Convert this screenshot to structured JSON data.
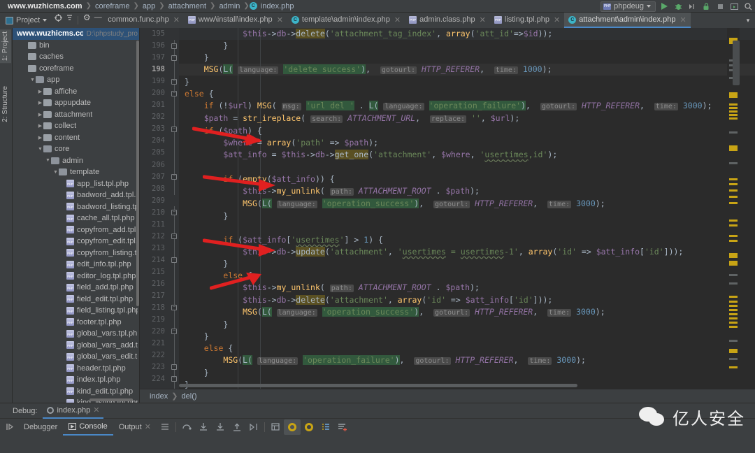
{
  "navbar": {
    "breadcrumbs": [
      "www.wuzhicms.com",
      "coreframe",
      "app",
      "attachment",
      "admin",
      "index.php"
    ],
    "run_config": "phpdeug",
    "php_badge": "PHP"
  },
  "toolwindow": {
    "project_button": "Project",
    "left_tabs": [
      "1: Project",
      "2: Structure"
    ]
  },
  "tabs": [
    {
      "label": "common.func.php",
      "icon": "php-file-icon",
      "active": false
    },
    {
      "label": "www\\install\\index.php",
      "icon": "php-file-icon",
      "active": false
    },
    {
      "label": "template\\admin\\index.php",
      "icon": "class-file-icon",
      "active": false
    },
    {
      "label": "admin.class.php",
      "icon": "php-file-icon",
      "active": false
    },
    {
      "label": "listing.tpl.php",
      "icon": "php-file-icon",
      "active": false
    },
    {
      "label": "attachment\\admin\\index.php",
      "icon": "class-file-icon",
      "active": true
    }
  ],
  "tree": {
    "root": {
      "name": "www.wuzhicms.com",
      "path": "D:\\phpstudy_pro"
    },
    "items": [
      {
        "label": "bin",
        "depth": 1,
        "type": "folder",
        "arrow": ""
      },
      {
        "label": "caches",
        "depth": 1,
        "type": "folder",
        "arrow": ""
      },
      {
        "label": "coreframe",
        "depth": 1,
        "type": "folder",
        "arrow": ""
      },
      {
        "label": "app",
        "depth": 2,
        "type": "folder",
        "arrow": "down"
      },
      {
        "label": "affiche",
        "depth": 3,
        "type": "folder",
        "arrow": "right"
      },
      {
        "label": "appupdate",
        "depth": 3,
        "type": "folder",
        "arrow": "right"
      },
      {
        "label": "attachment",
        "depth": 3,
        "type": "folder",
        "arrow": "right"
      },
      {
        "label": "collect",
        "depth": 3,
        "type": "folder",
        "arrow": "right"
      },
      {
        "label": "content",
        "depth": 3,
        "type": "folder",
        "arrow": "right"
      },
      {
        "label": "core",
        "depth": 3,
        "type": "folder",
        "arrow": "down"
      },
      {
        "label": "admin",
        "depth": 4,
        "type": "folder",
        "arrow": "down"
      },
      {
        "label": "template",
        "depth": 5,
        "type": "folder",
        "arrow": "down"
      },
      {
        "label": "app_list.tpl.php",
        "depth": 6,
        "type": "file",
        "arrow": ""
      },
      {
        "label": "badword_add.tpl.ph",
        "depth": 6,
        "type": "file",
        "arrow": ""
      },
      {
        "label": "badword_listing.tpl.",
        "depth": 6,
        "type": "file",
        "arrow": ""
      },
      {
        "label": "cache_all.tpl.php",
        "depth": 6,
        "type": "file",
        "arrow": ""
      },
      {
        "label": "copyfrom_add.tpl.ph",
        "depth": 6,
        "type": "file",
        "arrow": ""
      },
      {
        "label": "copyfrom_edit.tpl.ph",
        "depth": 6,
        "type": "file",
        "arrow": ""
      },
      {
        "label": "copyfrom_listing.tpl.",
        "depth": 6,
        "type": "file",
        "arrow": ""
      },
      {
        "label": "edit_info.tpl.php",
        "depth": 6,
        "type": "file",
        "arrow": ""
      },
      {
        "label": "editor_log.tpl.php",
        "depth": 6,
        "type": "file",
        "arrow": ""
      },
      {
        "label": "field_add.tpl.php",
        "depth": 6,
        "type": "file",
        "arrow": ""
      },
      {
        "label": "field_edit.tpl.php",
        "depth": 6,
        "type": "file",
        "arrow": ""
      },
      {
        "label": "field_listing.tpl.php",
        "depth": 6,
        "type": "file",
        "arrow": ""
      },
      {
        "label": "footer.tpl.php",
        "depth": 6,
        "type": "file",
        "arrow": ""
      },
      {
        "label": "global_vars.tpl.php",
        "depth": 6,
        "type": "file",
        "arrow": ""
      },
      {
        "label": "global_vars_add.tpl.",
        "depth": 6,
        "type": "file",
        "arrow": ""
      },
      {
        "label": "global_vars_edit.tpl.",
        "depth": 6,
        "type": "file",
        "arrow": ""
      },
      {
        "label": "header.tpl.php",
        "depth": 6,
        "type": "file",
        "arrow": ""
      },
      {
        "label": "index.tpl.php",
        "depth": 6,
        "type": "file",
        "arrow": ""
      },
      {
        "label": "kind_edit.tpl.php",
        "depth": 6,
        "type": "file",
        "arrow": ""
      },
      {
        "label": "kind_listing.tpl.php",
        "depth": 6,
        "type": "file",
        "arrow": ""
      }
    ]
  },
  "editor": {
    "first_line": 195,
    "last_line": 224,
    "current_line": 198,
    "breadcrumb": [
      "index",
      "del()"
    ],
    "browsers": [
      "chrome-icon",
      "firefox-icon",
      "safari-icon",
      "opera-icon",
      "ie-icon",
      "edge-icon"
    ],
    "lines": [
      {
        "n": 195,
        "indent": 0,
        "text": "$this->db->delete('attachment_tag_index', array('att_id'=>$id));"
      },
      {
        "n": 196,
        "indent": 0,
        "text": "}"
      },
      {
        "n": 197,
        "indent": 0,
        "text": "}"
      },
      {
        "n": 198,
        "indent": 0,
        "text": "MSG(L( language: 'delete success'),  gotourl: HTTP_REFERER,  time: 1000);"
      },
      {
        "n": 199,
        "indent": 0,
        "text": "}"
      },
      {
        "n": 200,
        "indent": 0,
        "text": "else {"
      },
      {
        "n": 201,
        "indent": 0,
        "text": "if (!$url) MSG( msg: 'url del ' . L( language: 'operation_failure'),  gotourl: HTTP_REFERER,  time: 3000);"
      },
      {
        "n": 202,
        "indent": 0,
        "text": "$path = str_ireplace( search: ATTACHMENT_URL,  replace: '', $url);"
      },
      {
        "n": 203,
        "indent": 0,
        "text": "if ($path) {"
      },
      {
        "n": 204,
        "indent": 0,
        "text": "$where = array('path' => $path);"
      },
      {
        "n": 205,
        "indent": 0,
        "text": "$att_info = $this->db->get_one('attachment', $where, 'usertimes,id');"
      },
      {
        "n": 206,
        "indent": 0,
        "text": ""
      },
      {
        "n": 207,
        "indent": 0,
        "text": "if (empty($att_info)) {"
      },
      {
        "n": 208,
        "indent": 0,
        "text": "$this->my_unlink( path: ATTACHMENT_ROOT . $path);"
      },
      {
        "n": 209,
        "indent": 0,
        "text": "MSG(L( language: 'operation_success'),  gotourl: HTTP_REFERER,  time: 3000);"
      },
      {
        "n": 210,
        "indent": 0,
        "text": "}"
      },
      {
        "n": 211,
        "indent": 0,
        "text": ""
      },
      {
        "n": 212,
        "indent": 0,
        "text": "if ($att_info['usertimes'] > 1) {"
      },
      {
        "n": 213,
        "indent": 0,
        "text": "$this->db->update('attachment', 'usertimes = usertimes-1', array('id' => $att_info['id']));"
      },
      {
        "n": 214,
        "indent": 0,
        "text": "}"
      },
      {
        "n": 215,
        "indent": 0,
        "text": "else {"
      },
      {
        "n": 216,
        "indent": 0,
        "text": "$this->my_unlink( path: ATTACHMENT_ROOT . $path);"
      },
      {
        "n": 217,
        "indent": 0,
        "text": "$this->db->delete('attachment', array('id' => $att_info['id']));"
      },
      {
        "n": 218,
        "indent": 0,
        "text": "MSG(L( language: 'operation_success'),  gotourl: HTTP_REFERER,  time: 3000);"
      },
      {
        "n": 219,
        "indent": 0,
        "text": "}"
      },
      {
        "n": 220,
        "indent": 0,
        "text": "}"
      },
      {
        "n": 221,
        "indent": 0,
        "text": "else {"
      },
      {
        "n": 222,
        "indent": 0,
        "text": "MSG(L( language: 'operation_failure'),  gotourl: HTTP_REFERER,  time: 3000);"
      },
      {
        "n": 223,
        "indent": 0,
        "text": "}"
      },
      {
        "n": 224,
        "indent": 0,
        "text": "}"
      }
    ]
  },
  "debug_panel": {
    "title": "Debug:",
    "session_tab": "index.php",
    "tabs": [
      "Debugger",
      "Console",
      "Output"
    ],
    "selected_tab": "Console"
  },
  "watermark": {
    "text": "亿人安全",
    "icon": "wechat-icon"
  }
}
